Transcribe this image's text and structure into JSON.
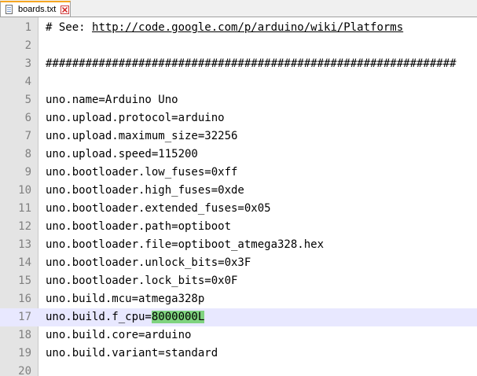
{
  "tab": {
    "filename": "boards.txt",
    "icon": "file-icon",
    "close_icon": "close-icon"
  },
  "colors": {
    "current_line": "#e8e8ff",
    "selection_highlight": "#7fd37f",
    "gutter": "#e4e4e4"
  },
  "lines": [
    {
      "num": "1",
      "text": "# See: ",
      "link": "http://code.google.com/p/arduino/wiki/Platforms"
    },
    {
      "num": "2",
      "text": ""
    },
    {
      "num": "3",
      "text": "##############################################################"
    },
    {
      "num": "4",
      "text": ""
    },
    {
      "num": "5",
      "text": "uno.name=Arduino Uno"
    },
    {
      "num": "6",
      "text": "uno.upload.protocol=arduino"
    },
    {
      "num": "7",
      "text": "uno.upload.maximum_size=32256"
    },
    {
      "num": "8",
      "text": "uno.upload.speed=115200"
    },
    {
      "num": "9",
      "text": "uno.bootloader.low_fuses=0xff"
    },
    {
      "num": "10",
      "text": "uno.bootloader.high_fuses=0xde"
    },
    {
      "num": "11",
      "text": "uno.bootloader.extended_fuses=0x05"
    },
    {
      "num": "12",
      "text": "uno.bootloader.path=optiboot"
    },
    {
      "num": "13",
      "text": "uno.bootloader.file=optiboot_atmega328.hex"
    },
    {
      "num": "14",
      "text": "uno.bootloader.unlock_bits=0x3F"
    },
    {
      "num": "15",
      "text": "uno.bootloader.lock_bits=0x0F"
    },
    {
      "num": "16",
      "text": "uno.build.mcu=atmega328p"
    },
    {
      "num": "17",
      "text": "uno.build.f_cpu=",
      "highlight": "8000000L",
      "current": true
    },
    {
      "num": "18",
      "text": "uno.build.core=arduino"
    },
    {
      "num": "19",
      "text": "uno.build.variant=standard"
    },
    {
      "num": "20",
      "text": ""
    }
  ]
}
